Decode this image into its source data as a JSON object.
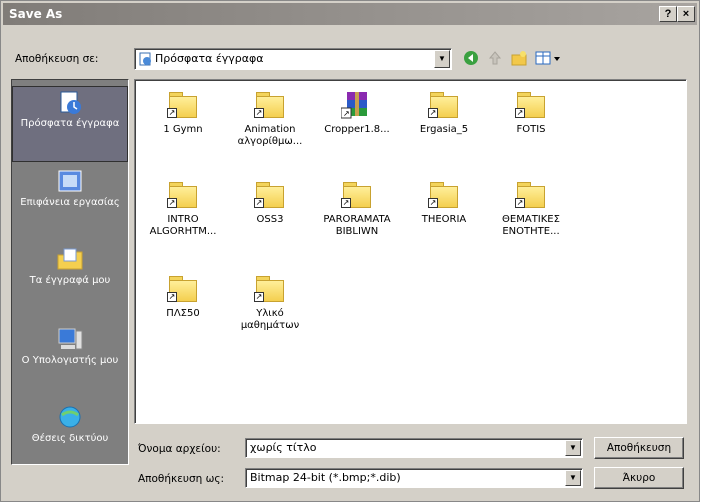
{
  "window": {
    "title": "Save As",
    "help_label": "?",
    "close_label": "×"
  },
  "save_in": {
    "label": "Αποθήκευση σε:",
    "value": "Πρόσφατα έγγραφα"
  },
  "toolbar": {
    "icons": [
      "back-icon",
      "up-folder-icon",
      "new-folder-icon",
      "views-icon"
    ]
  },
  "places": [
    {
      "label": "Πρόσφατα έγγραφα",
      "icon": "recent-documents-icon",
      "selected": true
    },
    {
      "label": "Επιφάνεια εργασίας",
      "icon": "desktop-icon",
      "selected": false
    },
    {
      "label": "Τα έγγραφά μου",
      "icon": "my-documents-icon",
      "selected": false
    },
    {
      "label": "Ο Υπολογιστής μου",
      "icon": "my-computer-icon",
      "selected": false
    },
    {
      "label": "Θέσεις δικτύου",
      "icon": "network-places-icon",
      "selected": false
    }
  ],
  "files": [
    {
      "name": "1 Gymn",
      "type": "folder-shortcut"
    },
    {
      "name": "Animation αλγορίθμω...",
      "type": "folder-shortcut"
    },
    {
      "name": "Cropper1.8...",
      "type": "winrar-shortcut"
    },
    {
      "name": "Ergasia_5",
      "type": "folder-shortcut"
    },
    {
      "name": "FOTIS",
      "type": "folder-shortcut"
    },
    {
      "name": "INTRO ALGORHTM...",
      "type": "folder-shortcut"
    },
    {
      "name": "OSS3",
      "type": "folder-shortcut"
    },
    {
      "name": "PARORAMATA BIBLIWN",
      "type": "folder-shortcut"
    },
    {
      "name": "THEORIA",
      "type": "folder-shortcut"
    },
    {
      "name": "ΘΕΜΑΤΙΚΕΣ ΕΝΟΤΗΤΕ...",
      "type": "folder-shortcut"
    },
    {
      "name": "ΠΛΣ50",
      "type": "folder-shortcut"
    },
    {
      "name": "Υλικό μαθημάτων",
      "type": "folder-shortcut"
    }
  ],
  "filename": {
    "label": "Όνομα αρχείου:",
    "value": "χωρίς τίτλο"
  },
  "save_as_type": {
    "label": "Αποθήκευση ως:",
    "value": "Bitmap 24-bit (*.bmp;*.dib)"
  },
  "buttons": {
    "save": "Αποθήκευση",
    "cancel": "Άκυρο"
  }
}
